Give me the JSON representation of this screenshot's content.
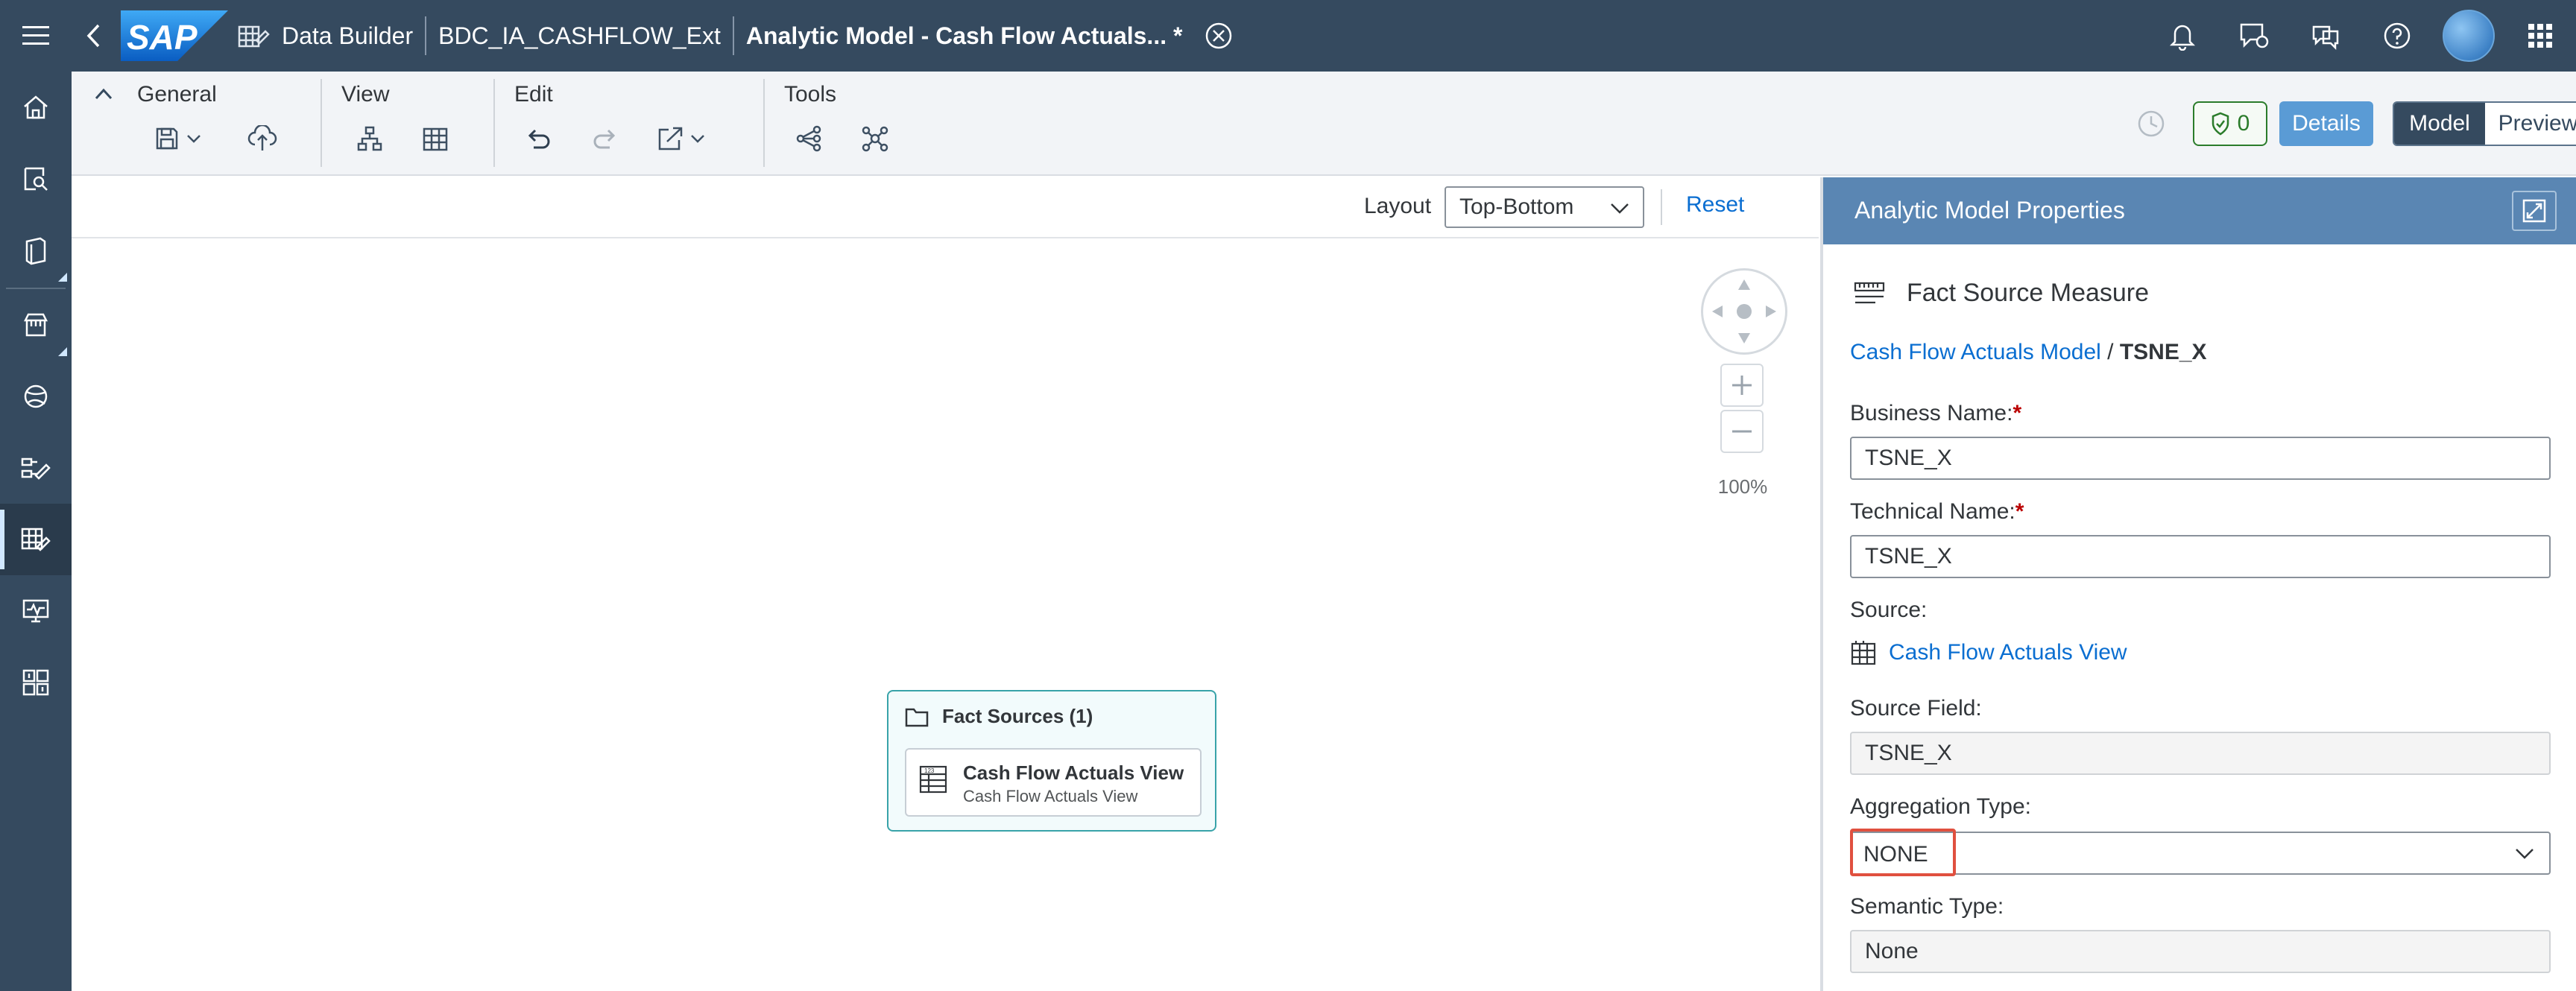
{
  "shell": {
    "crumbs": [
      "Data Builder",
      "BDC_IA_CASHFLOW_Ext"
    ],
    "title": "Analytic Model - Cash Flow Actuals... *",
    "logo": "SAP"
  },
  "toolbar": {
    "groups": [
      "General",
      "View",
      "Edit",
      "Tools"
    ],
    "badge_count": "0",
    "details_label": "Details",
    "model_label": "Model",
    "preview_label": "Preview"
  },
  "canvas": {
    "layout_label": "Layout",
    "layout_value": "Top-Bottom",
    "reset_label": "Reset",
    "zoom_level": "100%",
    "fact_sources_title": "Fact Sources (1)",
    "entity_title": "Cash Flow Actuals View",
    "entity_subtitle": "Cash Flow Actuals View"
  },
  "panel": {
    "title": "Analytic Model Properties",
    "section_title": "Fact Source Measure",
    "breadcrumb_link": "Cash Flow Actuals Model",
    "breadcrumb_sep": "/",
    "breadcrumb_current": "TSNE_X",
    "business_name_label": "Business Name:",
    "business_name_value": "TSNE_X",
    "technical_name_label": "Technical Name:",
    "technical_name_value": "TSNE_X",
    "source_label": "Source:",
    "source_value": "Cash Flow Actuals View",
    "source_field_label": "Source Field:",
    "source_field_value": "TSNE_X",
    "aggregation_label": "Aggregation Type:",
    "aggregation_value": "NONE",
    "semantic_label": "Semantic Type:",
    "semantic_value": "None",
    "required_mark": "*"
  },
  "colors": {
    "shell": "#354a5f",
    "accent": "#0a6ed1",
    "panel_header": "#5a86b3",
    "highlight": "#e0503f"
  }
}
